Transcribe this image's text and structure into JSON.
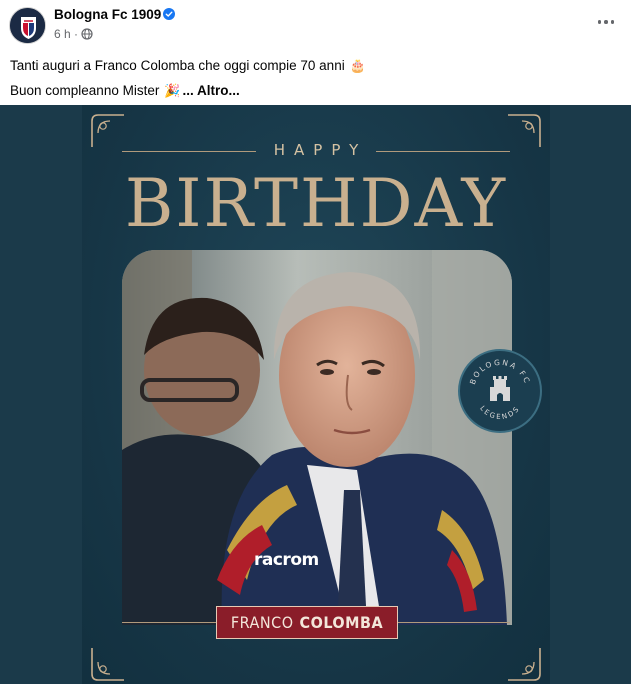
{
  "post": {
    "page_name": "Bologna Fc 1909",
    "timestamp": "6 h ·",
    "audience_icon": "globe-icon",
    "more_icon": "more-options-icon",
    "caption_line1": "Tanti auguri a Franco Colomba che oggi compie 70 anni",
    "caption_line1_emoji": "🎂",
    "caption_line2": "Buon compleanno Mister",
    "caption_line2_emoji": "🎉",
    "see_more": "... Altro..."
  },
  "image": {
    "happy": "HAPPY",
    "birthday": "BIRTHDAY",
    "name_first": "FRANCO",
    "name_last": "COLOMBA",
    "jacket_brand": "racrom",
    "badge_top": "BOLOGNA FC",
    "badge_bottom": "LEGENDS"
  },
  "colors": {
    "background": "#1b3a4a",
    "gold": "#c9b08f",
    "name_plate": "#8a1d29",
    "verified": "#1877f2"
  }
}
